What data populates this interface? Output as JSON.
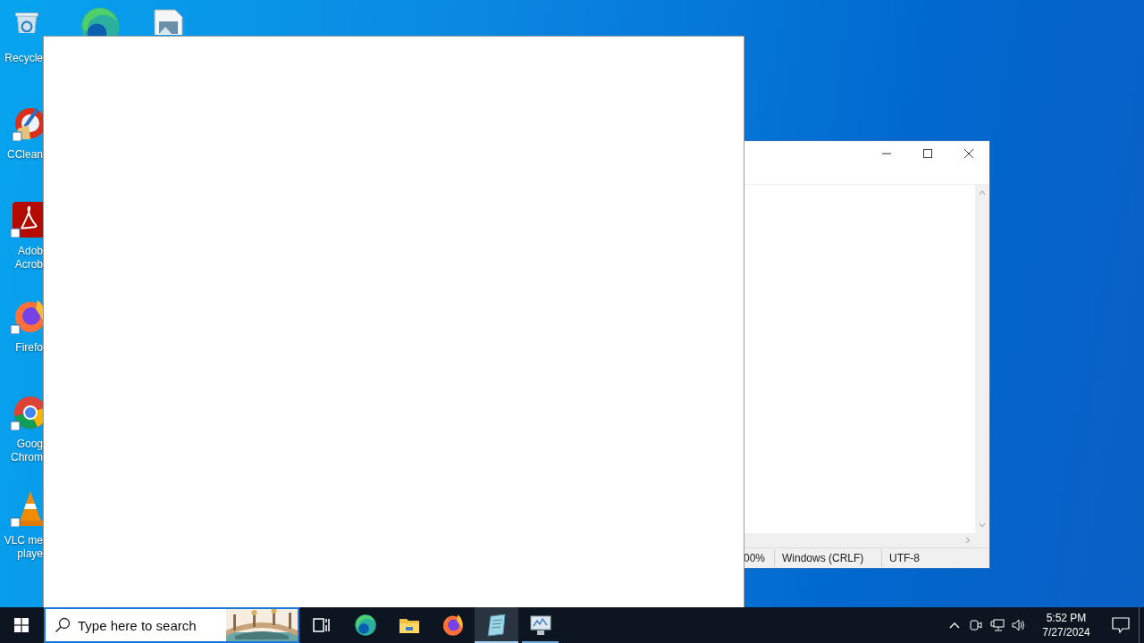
{
  "desktop_icons": [
    {
      "kind": "recycle-bin",
      "lines": [
        "Recycle"
      ]
    },
    {
      "kind": "edge"
    },
    {
      "kind": "image-file"
    },
    {
      "kind": "ccleaner",
      "lines": [
        "CClean"
      ]
    },
    {
      "kind": "acrobat",
      "lines": [
        "Adob",
        "Acrob"
      ]
    },
    {
      "kind": "firefox",
      "lines": [
        "Firefo"
      ]
    },
    {
      "kind": "chrome",
      "lines": [
        "Goog",
        "Chrom"
      ]
    },
    {
      "kind": "vlc",
      "lines": [
        "VLC me",
        "playe"
      ]
    }
  ],
  "notepad": {
    "status_bar": [
      "00%",
      "Windows (CRLF)",
      "UTF-8"
    ]
  },
  "taskbar": {
    "search": {
      "placeholder": "Type here to search"
    },
    "apps": [
      {
        "kind": "task-view",
        "running": false,
        "selected": false
      },
      {
        "kind": "edge",
        "running": false,
        "selected": false
      },
      {
        "kind": "folder",
        "running": false,
        "selected": false
      },
      {
        "kind": "firefox",
        "running": false,
        "selected": false
      },
      {
        "kind": "notepad",
        "running": true,
        "selected": true
      },
      {
        "kind": "monitor",
        "running": true,
        "selected": false
      }
    ],
    "clock": {
      "time": "5:52 PM",
      "date": "7/27/2024"
    }
  }
}
